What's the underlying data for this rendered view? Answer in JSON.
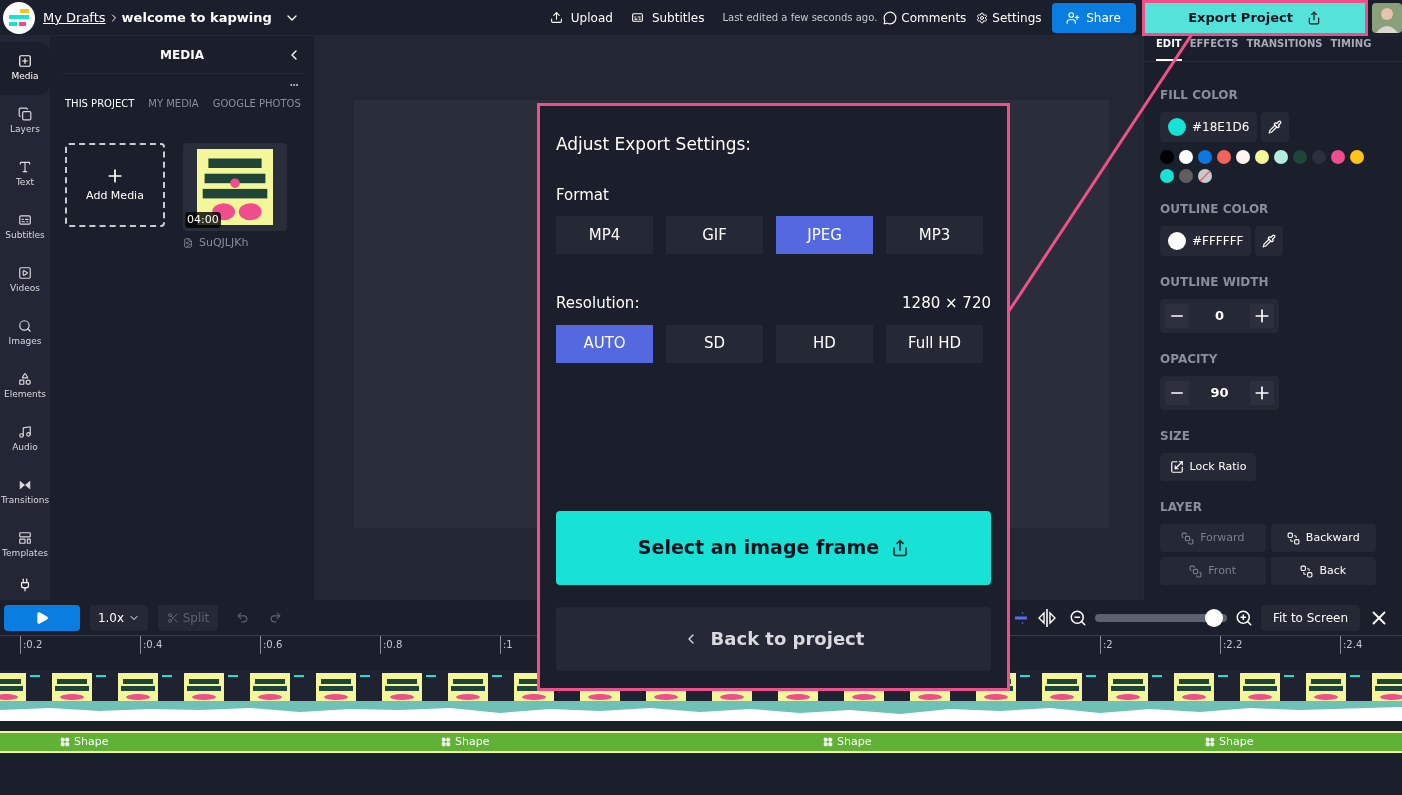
{
  "topbar": {
    "breadcrumb": "My Drafts",
    "project": "welcome to kapwing",
    "actions": [
      {
        "label": "Upload"
      },
      {
        "label": "Subtitles"
      }
    ],
    "last_edited": "Last edited a few seconds ago.",
    "comments": "Comments",
    "settings": "Settings",
    "share": "Share",
    "export": "Export Project"
  },
  "sidebar": [
    {
      "label": "Media",
      "selected": true
    },
    {
      "label": "Layers",
      "selected": false
    },
    {
      "label": "Text",
      "selected": false
    },
    {
      "label": "Subtitles",
      "selected": false
    },
    {
      "label": "Videos",
      "selected": false
    },
    {
      "label": "Images",
      "selected": false
    },
    {
      "label": "Elements",
      "selected": false
    },
    {
      "label": "Audio",
      "selected": false
    },
    {
      "label": "Transitions",
      "selected": false
    },
    {
      "label": "Templates",
      "selected": false
    }
  ],
  "media_panel": {
    "title": "MEDIA",
    "tabs": [
      {
        "label": "THIS PROJECT",
        "selected": true
      },
      {
        "label": "MY MEDIA",
        "selected": false
      },
      {
        "label": "GOOGLE PHOTOS",
        "selected": false
      }
    ],
    "add_media": "Add Media",
    "items": [
      {
        "duration": "04:00",
        "name": "SuQJLJKh"
      }
    ]
  },
  "export_dialog": {
    "title": "Adjust Export Settings:",
    "format_label": "Format",
    "formats": [
      {
        "label": "MP4",
        "selected": false
      },
      {
        "label": "GIF",
        "selected": false
      },
      {
        "label": "JPEG",
        "selected": true
      },
      {
        "label": "MP3",
        "selected": false
      }
    ],
    "resolution_label": "Resolution:",
    "resolution_value": "1280 × 720",
    "resolutions": [
      {
        "label": "AUTO",
        "selected": true
      },
      {
        "label": "SD",
        "selected": false
      },
      {
        "label": "HD",
        "selected": false
      },
      {
        "label": "Full HD",
        "selected": false
      }
    ],
    "primary_button": "Select an image frame",
    "back_button": "Back to project"
  },
  "properties": {
    "tabs": [
      {
        "label": "EDIT",
        "selected": true
      },
      {
        "label": "EFFECTS",
        "selected": false
      },
      {
        "label": "TRANSITIONS",
        "selected": false
      },
      {
        "label": "TIMING",
        "selected": false
      }
    ],
    "fill_color": {
      "label": "FILL COLOR",
      "value": "#18E1D6",
      "color": "#18e1d6"
    },
    "swatches": [
      {
        "kind": "color",
        "color": "#000000"
      },
      {
        "kind": "color",
        "color": "#ffffff"
      },
      {
        "kind": "color",
        "color": "#0a78e0"
      },
      {
        "kind": "color",
        "color": "#f2645a"
      },
      {
        "kind": "color",
        "color": "#fdf7ef"
      },
      {
        "kind": "color",
        "color": "#f4f69a"
      },
      {
        "kind": "color",
        "color": "#b2eedb"
      },
      {
        "kind": "color",
        "color": "#1f4438"
      },
      {
        "kind": "color",
        "color": "#2c2f3d"
      },
      {
        "kind": "color",
        "color": "#ef4d8c"
      },
      {
        "kind": "color",
        "color": "#fcc51b"
      },
      {
        "kind": "color",
        "color": "#18e1d6"
      },
      {
        "kind": "color",
        "color": "#5e5e5e"
      },
      {
        "kind": "none"
      }
    ],
    "outline_color": {
      "label": "OUTLINE COLOR",
      "value": "#FFFFFF",
      "color": "#ffffff"
    },
    "outline_width": {
      "label": "OUTLINE WIDTH",
      "value": "0"
    },
    "opacity": {
      "label": "OPACITY",
      "value": "90"
    },
    "size": {
      "label": "SIZE",
      "button": "Lock Ratio"
    },
    "layer": {
      "label": "LAYER",
      "buttons": [
        {
          "label": "Forward",
          "disabled": true
        },
        {
          "label": "Backward",
          "disabled": false
        },
        {
          "label": "Front",
          "disabled": true
        },
        {
          "label": "Back",
          "disabled": false
        }
      ]
    }
  },
  "timeline": {
    "speed": "1.0x",
    "split": {
      "label": "Split",
      "disabled": true
    },
    "zoom": {
      "level": 0.9
    },
    "fit": "Fit to Screen",
    "ticks_left": [
      ":0.2",
      ":0.4",
      ":0.6",
      ":0.8",
      ":1"
    ],
    "ticks_right": [
      ":2",
      ":2.2",
      ":2.4"
    ],
    "track_labels": [
      {
        "label": "Shape"
      },
      {
        "label": "Shape"
      },
      {
        "label": "Shape"
      },
      {
        "label": "Shape"
      }
    ]
  }
}
